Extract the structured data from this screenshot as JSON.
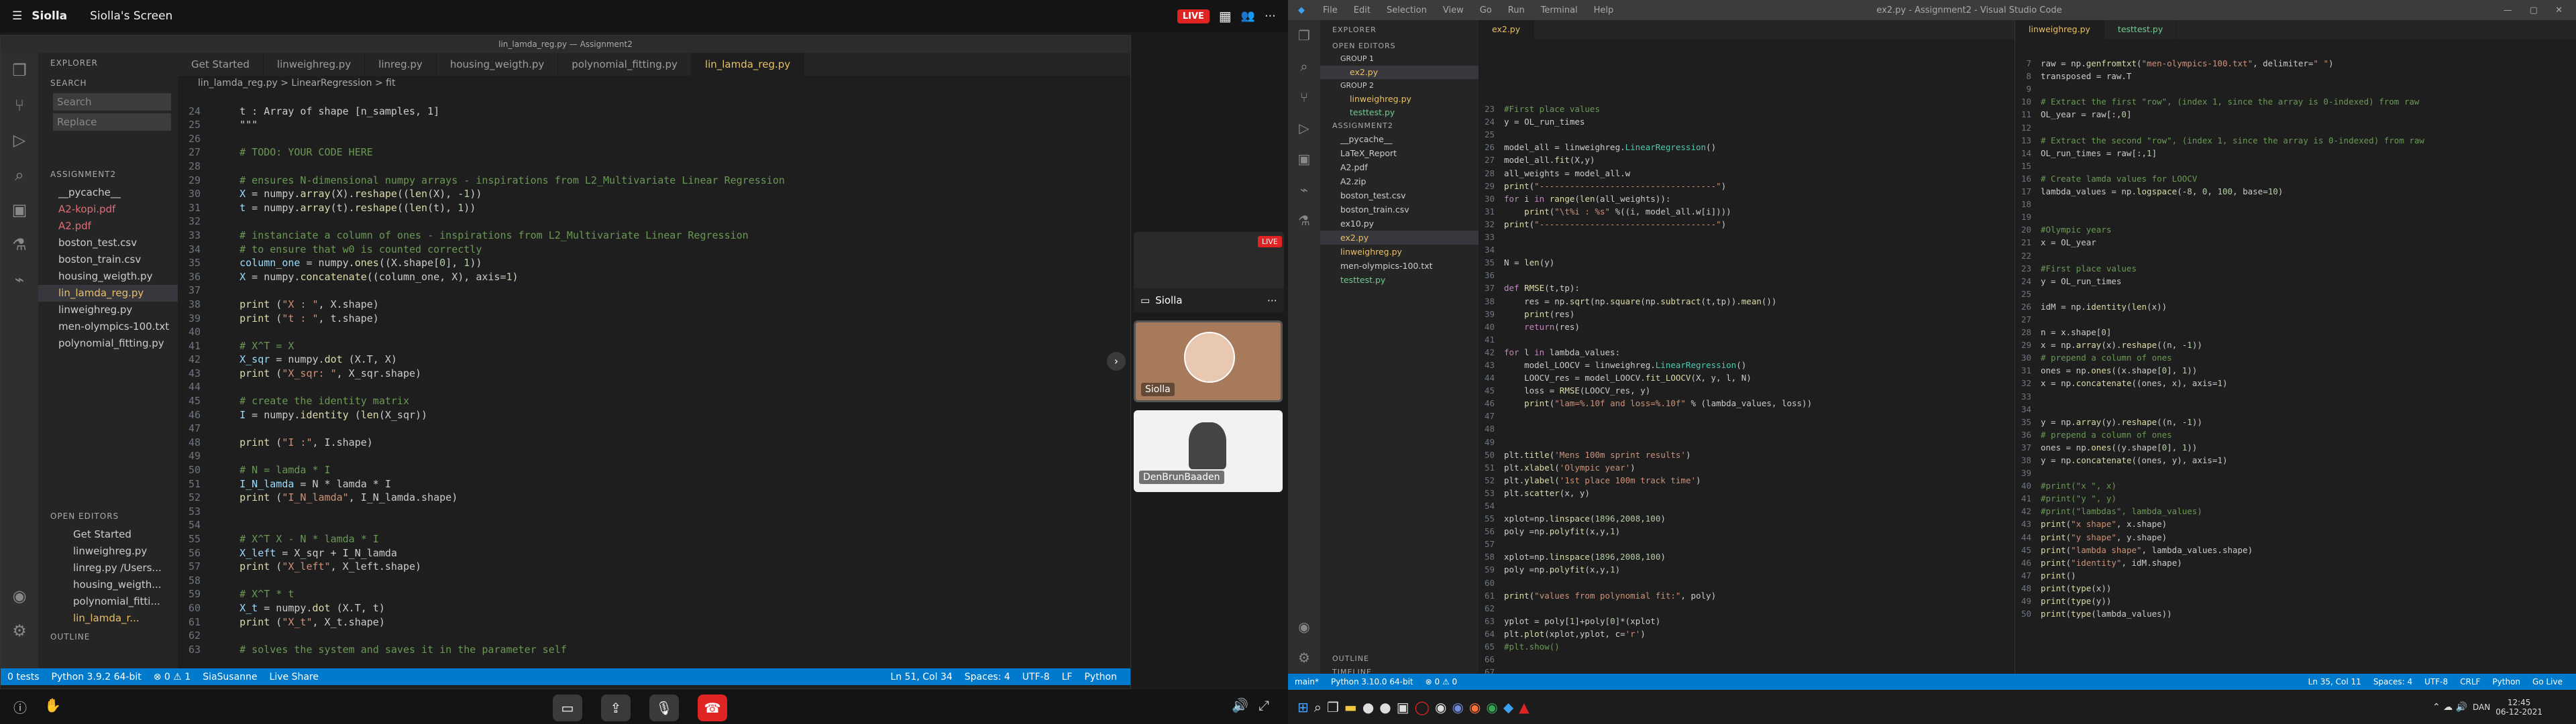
{
  "share": {
    "app": "Siolla",
    "screen_title": "Siolla's Screen",
    "live": "LIVE",
    "window_title": "lin_lamda_reg.py — Assignment2"
  },
  "left_vs": {
    "explorer_title": "EXPLORER",
    "search_hdr": "SEARCH",
    "search_placeholder": "Search",
    "replace_placeholder": "Replace",
    "folder": "ASSIGNMENT2",
    "files": [
      "__pycache__",
      "A2-kopi.pdf",
      "A2.pdf",
      "boston_test.csv",
      "boston_train.csv",
      "housing_weigth.py",
      "lin_lamda_reg.py",
      "linweighreg.py",
      "men-olympics-100.txt",
      "polynomial_fitting.py"
    ],
    "open_editors": "OPEN EDITORS",
    "open_files": [
      "Get Started",
      "linweighreg.py",
      "linreg.py /Users...",
      "housing_weigth...",
      "polynomial_fitti...",
      "lin_lamda_r..."
    ],
    "outline": "OUTLINE",
    "tabs": [
      "Get Started",
      "linweighreg.py",
      "linreg.py",
      "housing_weigth.py",
      "polynomial_fitting.py",
      "lin_lamda_reg.py"
    ],
    "breadcrumb": "lin_lamda_reg.py > LinearRegression > fit",
    "status": {
      "branch": "0 tests",
      "python": "Python 3.9.2 64-bit",
      "errors": "⊗ 0 ⚠ 1",
      "user": "SiaSusanne",
      "live": "Live Share",
      "pos": "Ln 51, Col 34",
      "spaces": "Spaces: 4",
      "enc": "UTF-8",
      "eol": "LF",
      "lang": "Python"
    }
  },
  "participants": [
    {
      "name": "Siolla"
    },
    {
      "name": "DenBrunBaaden"
    }
  ],
  "right_vs": {
    "menu": [
      "File",
      "Edit",
      "Selection",
      "View",
      "Go",
      "Run",
      "Terminal",
      "Help"
    ],
    "title": "ex2.py - Assignment2 - Visual Studio Code",
    "explorer": "EXPLORER",
    "open_editors": "OPEN EDITORS",
    "group1": "GROUP 1",
    "group2": "GROUP 2",
    "g1": [
      "ex2.py"
    ],
    "g2": [
      "linweighreg.py",
      "testtest.py"
    ],
    "folder": "ASSIGNMENT2",
    "files": [
      "__pycache__",
      "LaTeX_Report",
      "A2.pdf",
      "A2.zip",
      "boston_test.csv",
      "boston_train.csv",
      "ex10.py",
      "ex2.py",
      "linweighreg.py",
      "men-olympics-100.txt",
      "testtest.py"
    ],
    "outline": "OUTLINE",
    "timeline": "TIMELINE",
    "tab_left": "ex2.py",
    "tabs_right": [
      "linweighreg.py",
      "testtest.py"
    ],
    "status": {
      "branch": "main*",
      "python": "Python 3.10.0 64-bit",
      "err": "⊗ 0 ⚠ 0",
      "pos": "Ln 35, Col 11",
      "spaces": "Spaces: 4",
      "enc": "UTF-8",
      "eol": "CRLF",
      "lang": "Python",
      "live": "Go Live"
    }
  },
  "taskbar": {
    "time": "12:45",
    "date": "06-12-2021",
    "lang": "DAN"
  }
}
